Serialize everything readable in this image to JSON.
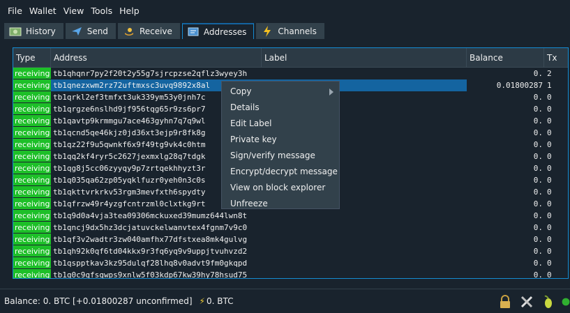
{
  "menubar": {
    "items": [
      "File",
      "Wallet",
      "View",
      "Tools",
      "Help"
    ]
  },
  "tabs": [
    {
      "label": "History",
      "icon": "history-icon",
      "active": false
    },
    {
      "label": "Send",
      "icon": "send-icon",
      "active": false
    },
    {
      "label": "Receive",
      "icon": "receive-icon",
      "active": false
    },
    {
      "label": "Addresses",
      "icon": "addresses-icon",
      "active": true
    },
    {
      "label": "Channels",
      "icon": "lightning-icon",
      "active": false
    }
  ],
  "table": {
    "columns": [
      "Type",
      "Address",
      "Label",
      "Balance",
      "Tx"
    ],
    "rows": [
      {
        "type": "receiving",
        "address": "tb1qhqnr7py2f20t2y55g7sjrcpzse2qflz3wyey3h",
        "label": "",
        "balance": "0.",
        "tx": "2"
      },
      {
        "type": "receiving",
        "address": "tb1qnezxwm2rz72uftmxsc3uvq9892x8al",
        "label": "",
        "balance": "0.01800287",
        "tx": "1"
      },
      {
        "type": "receiving",
        "address": "tb1qrkl2ef3tmfxt3uk339ym53y0jnh7c",
        "label": "",
        "balance": "0.",
        "tx": "0"
      },
      {
        "type": "receiving",
        "address": "tb1qrgze6nslhd9jf956tqg65r9zs6pr7",
        "label": "",
        "balance": "0.",
        "tx": "0"
      },
      {
        "type": "receiving",
        "address": "tb1qavtp9krmmgu7ace463gyhn7q7q9wl",
        "label": "",
        "balance": "0.",
        "tx": "0"
      },
      {
        "type": "receiving",
        "address": "tb1qcnd5qe46kjz0jd36xt3ejp9r8fk8g",
        "label": "",
        "balance": "0.",
        "tx": "0"
      },
      {
        "type": "receiving",
        "address": "tb1qz22f9u5qwnkf6x9f49tg9vk4c0htm",
        "label": "",
        "balance": "0.",
        "tx": "0"
      },
      {
        "type": "receiving",
        "address": "tb1qq2kf4ryr5c2627jexmxlg28q7tdgk",
        "label": "",
        "balance": "0.",
        "tx": "0"
      },
      {
        "type": "receiving",
        "address": "tb1qg8j5cc06zyyqy9p7zrtqekhhyzt3r",
        "label": "",
        "balance": "0.",
        "tx": "0"
      },
      {
        "type": "receiving",
        "address": "tb1q035qa62zp05yqklfuzr0yeh0n3c0s",
        "label": "",
        "balance": "0.",
        "tx": "0"
      },
      {
        "type": "receiving",
        "address": "tb1qkttvrkrkv53rgm3mevfxth6spydty",
        "label": "",
        "balance": "0.",
        "tx": "0"
      },
      {
        "type": "receiving",
        "address": "tb1qfrzw49r4yzgfcntrzml0clxtkg9rt",
        "label": "",
        "balance": "0.",
        "tx": "0"
      },
      {
        "type": "receiving",
        "address": "tb1q9d0a4vja3tea09306mckuxed39mumz644lwn8t",
        "label": "",
        "balance": "0.",
        "tx": "0"
      },
      {
        "type": "receiving",
        "address": "tb1qncj9dx5hz3dcjatuvckelwanvtex4fgnm7v9c0",
        "label": "",
        "balance": "0.",
        "tx": "0"
      },
      {
        "type": "receiving",
        "address": "tb1qf3v2wadtr3zw040amfhx77dfstxea8mk4gulvg",
        "label": "",
        "balance": "0.",
        "tx": "0"
      },
      {
        "type": "receiving",
        "address": "tb1qh92k0qf6td04kkx9r3fq6yq9v9uppjtvuhvzd2",
        "label": "",
        "balance": "0.",
        "tx": "0"
      },
      {
        "type": "receiving",
        "address": "tb1qspptkav3kz95dulqf28lhq8v0advt9fm0gkqpd",
        "label": "",
        "balance": "0.",
        "tx": "0"
      },
      {
        "type": "receiving",
        "address": "tb1q0c9qfsqwps9xnlw5f03kdp67kw39hy78hsud75",
        "label": "",
        "balance": "0.",
        "tx": "0"
      }
    ]
  },
  "context_menu": {
    "items": [
      "Copy",
      "Details",
      "Edit Label",
      "Private key",
      "Sign/verify message",
      "Encrypt/decrypt message",
      "View on block explorer",
      "Unfreeze"
    ]
  },
  "status": {
    "balance_text": "Balance: 0. BTC  [+0.01800287 unconfirmed]",
    "lightning_text": "0. BTC"
  },
  "colors": {
    "receiving": "#1dbf28",
    "selection": "#1464a0",
    "background": "#19232d"
  }
}
